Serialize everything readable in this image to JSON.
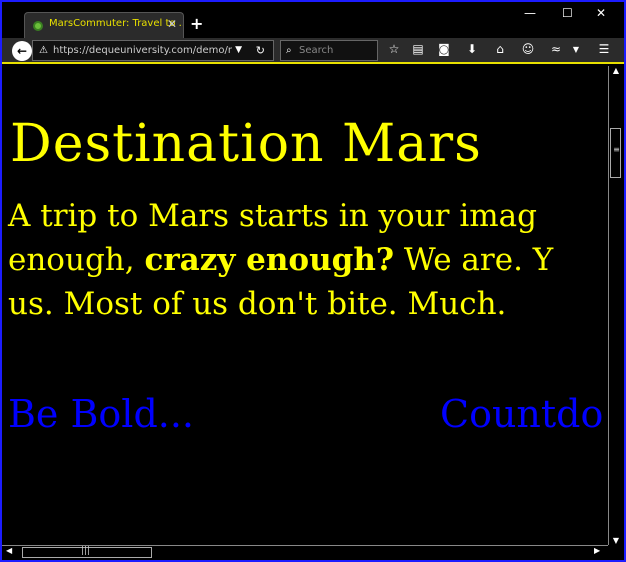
{
  "browser": {
    "tab_title": "MarsCommuter: Travel to ...",
    "url": "https://dequeuniversity.com/demo/m",
    "search_placeholder": "Search"
  },
  "page": {
    "heading": "Destination Mars",
    "intro_line1": "A trip to Mars starts in your imag",
    "intro_line2_pre": "enough, ",
    "intro_line2_bold": "crazy enough?",
    "intro_line2_post": " We are. Y",
    "intro_line3": "us. Most of us don't bite. Much.",
    "link_left": "Be Bold...",
    "link_right": "Countdo"
  },
  "colors": {
    "background": "#000000",
    "text": "#ffff00",
    "link": "#0000ff",
    "window_border": "#1c1cff"
  }
}
